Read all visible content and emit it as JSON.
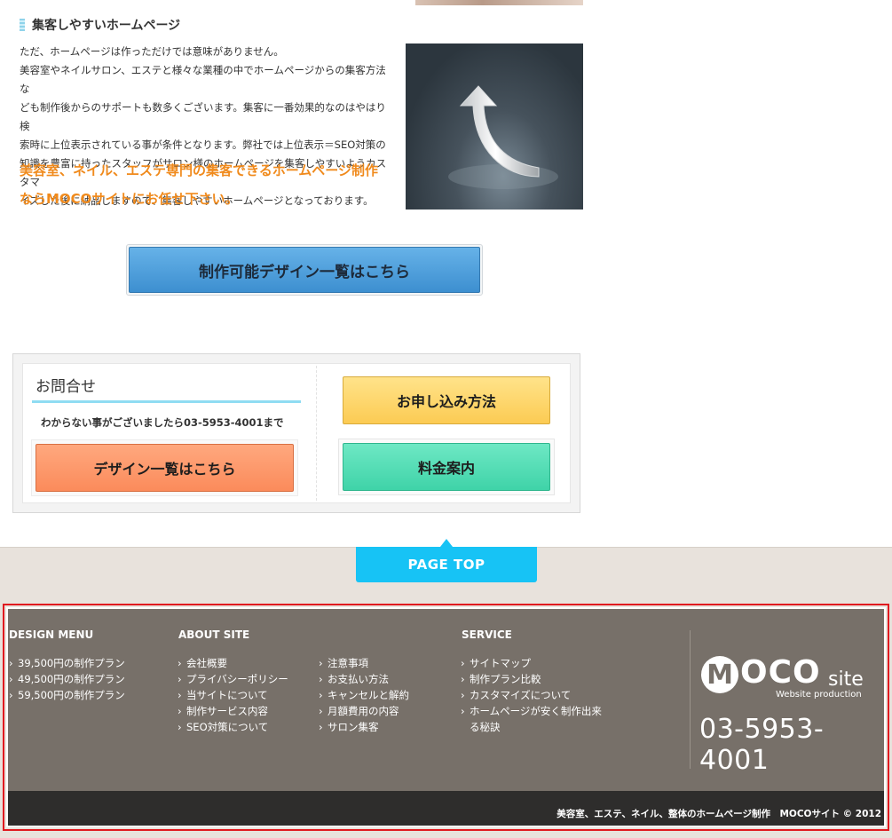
{
  "section": {
    "heading": "集客しやすいホームページ",
    "paragraph_lines": [
      "ただ、ホームページは作っただけでは意味がありません。",
      "美容室やネイルサロン、エステと様々な業種の中でホームページからの集客方法な",
      "ども制作後からのサポートも数多くございます。集客に一番効果的なのはやはり検",
      "索時に上位表示されている事が条件となります。弊社では上位表示＝SEO対策の",
      "知識を豊富に持ったスタッフがサロン様のホームページを集客しやすいようカスタマ",
      "イズした後に納品しますので、集客しやすいホームページとなっております。"
    ],
    "highlight_lines": [
      "美容室、ネイル、エステ専門の集客できるホームページ制作",
      "ならMOCOサイトにお任せ下さい。"
    ]
  },
  "design_list_button": "制作可能デザイン一覧はこちら",
  "contact": {
    "title": "お問合せ",
    "note": "わからない事がございましたら03-5953-4001まで",
    "apply_button": "お申し込み方法",
    "design_button": "デザイン一覧はこちら",
    "price_button": "料金案内"
  },
  "page_top": "PAGE TOP",
  "footer": {
    "design_menu": {
      "title": "DESIGN MENU",
      "items": [
        "39,500円の制作プラン",
        "49,500円の制作プラン",
        "59,500円の制作プラン"
      ]
    },
    "about_site": {
      "title": "ABOUT SITE",
      "items_a": [
        "会社概要",
        "プライバシーポリシー",
        "当サイトについて",
        "制作サービス内容",
        "SEO対策について"
      ],
      "items_b": [
        "注意事項",
        "お支払い方法",
        "キャンセルと解約",
        "月額費用の内容",
        "サロン集客"
      ]
    },
    "service": {
      "title": "SERVICE",
      "items": [
        "サイトマップ",
        "制作プラン比較",
        "カスタマイズについて",
        "ホームページが安く制作出来",
        "る秘訣"
      ]
    },
    "logo": {
      "m": "M",
      "oco": "OCO",
      "site": "site",
      "tagline": "Website production"
    },
    "phone": "03-5953-4001",
    "copyright": "美容室、エステ、ネイル、整体のホームページ制作　MOCOサイト © 2012"
  },
  "colors": {
    "accent_blue": "#17c3f5",
    "orange_text": "#f08a1c",
    "footer_bg": "#777069",
    "highlight_frame": "#e0191f"
  }
}
